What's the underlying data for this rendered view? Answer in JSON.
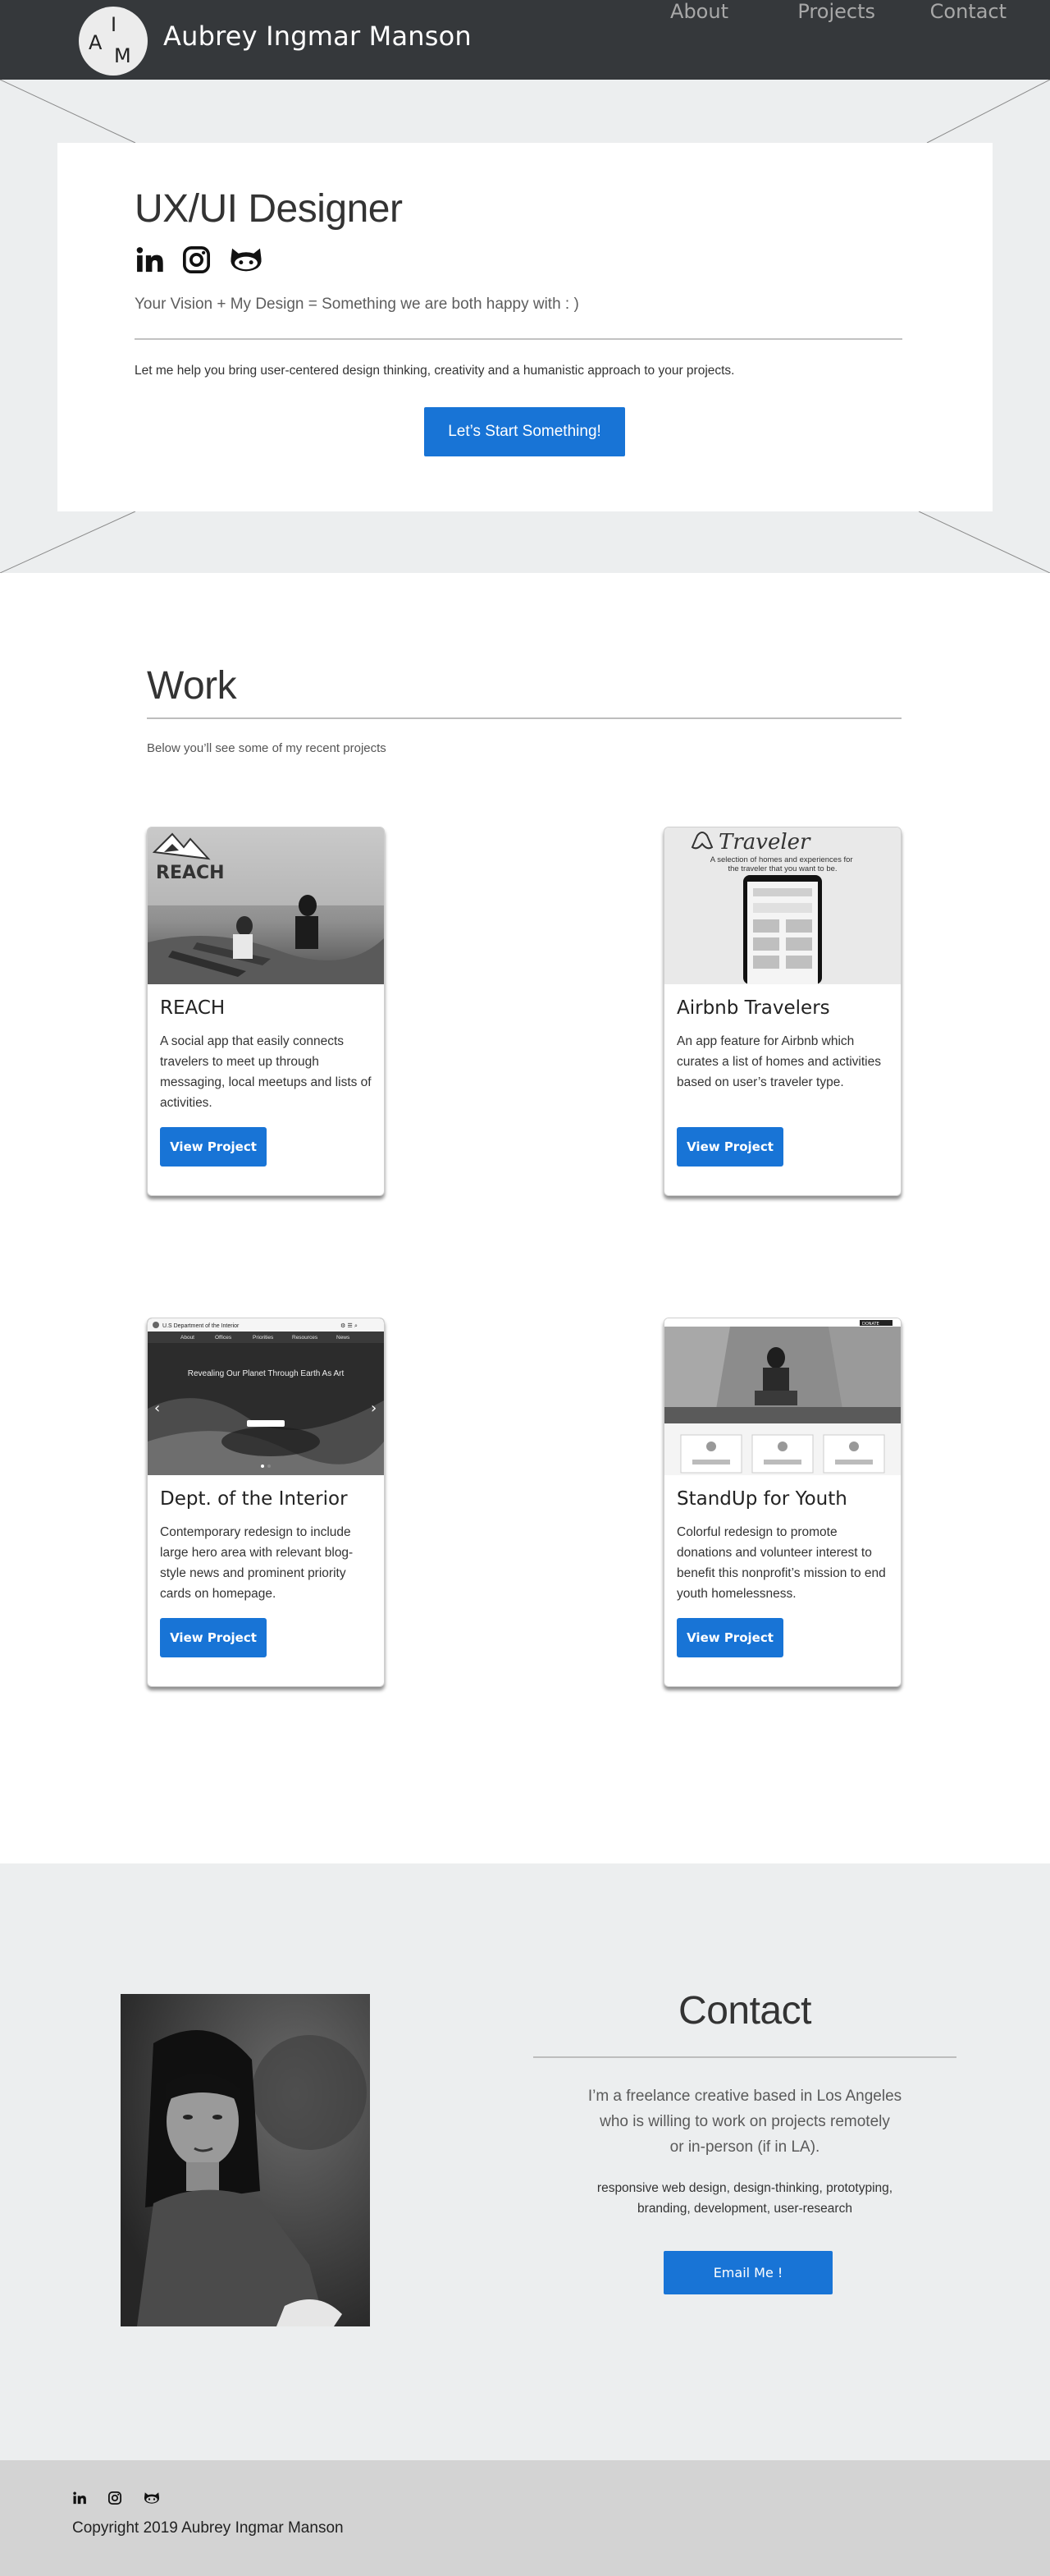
{
  "nav": {
    "logo_letters": {
      "a": "A",
      "i": "I",
      "m": "M"
    },
    "brand": "Aubrey Ingmar Manson",
    "links": [
      "About",
      "Projects",
      "Contact"
    ]
  },
  "hero": {
    "title": "UX/UI Designer",
    "social_icons": [
      "linkedin-icon",
      "instagram-icon",
      "github-icon"
    ],
    "tagline": "Your Vision +  My Design = Something we are both happy with : )",
    "body": "Let me help you bring user-centered design thinking, creativity and a humanistic approach to your projects.",
    "cta": "Let’s Start Something!"
  },
  "work": {
    "title": "Work",
    "subtitle": "Below you’ll see some of my recent projects",
    "cards": [
      {
        "title": "REACH",
        "description": "A social app that easily connects travelers to meet up through messaging, local meetups and lists of activities.",
        "button": "View Project",
        "image_text": "REACH"
      },
      {
        "title": "Airbnb Travelers",
        "description": "An app feature for Airbnb which curates a list of homes and activities based on user’s traveler type.",
        "button": "View Project",
        "image_text": "Traveler",
        "image_subtext": "A selection of homes and experiences for the traveler that you want to be."
      },
      {
        "title": "Dept. of the Interior",
        "description": "Contemporary redesign to include large hero area with relevant blog-style news and prominent priority cards on homepage.",
        "button": "View Project",
        "image_text": "U.S Department of the Interior",
        "image_subtext": "Revealing Our Planet Through Earth As Art",
        "image_menu": [
          "About",
          "Offices",
          "Priorities",
          "Resources",
          "News"
        ]
      },
      {
        "title": "StandUp for Youth",
        "description": "Colorful redesign to promote donations and volunteer interest to benefit this nonprofit’s mission to end youth homelessness.",
        "button": "View Project",
        "image_text": "DONATE"
      }
    ]
  },
  "contact": {
    "title": "Contact",
    "lines": [
      "I’m a freelance creative based in Los Angeles",
      "who is willing to work on projects remotely",
      "or in-person (if in LA)."
    ],
    "skills": [
      "responsive web design, design-thinking, prototyping,",
      "branding, development, user-research"
    ],
    "button": "Email Me !"
  },
  "footer": {
    "social_icons": [
      "linkedin-icon",
      "instagram-icon",
      "github-icon"
    ],
    "copyright": "Copyright 2019 Aubrey Ingmar Manson"
  },
  "colors": {
    "nav_bg": "#35383b",
    "accent_blue": "#1874d6",
    "band_gray": "#eceeef",
    "footer_gray": "#d3d3d3"
  }
}
